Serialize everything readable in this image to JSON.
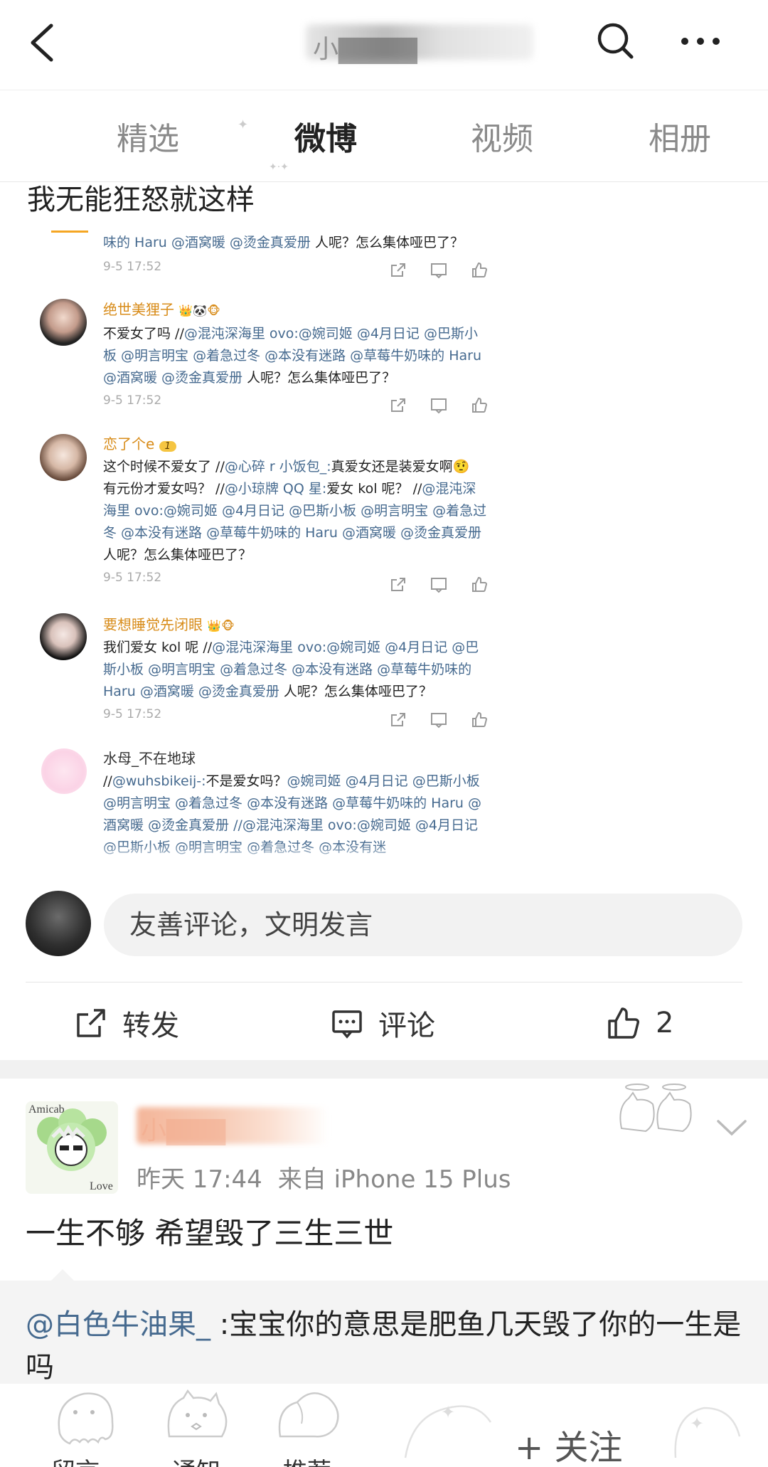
{
  "header": {
    "title": "小▇▇▇▇"
  },
  "tabs": [
    {
      "label": "精选",
      "active": false
    },
    {
      "label": "微博",
      "active": true
    },
    {
      "label": "视频",
      "active": false
    },
    {
      "label": "相册",
      "active": false
    }
  ],
  "embedded": {
    "heading": "我无能狂怒就这样",
    "comments": [
      {
        "name": "",
        "text_plain": "",
        "text_links": "味的 Haru @酒窝暖 @烫金真爱册 ",
        "text_tail": "人呢？怎么集体哑巴了？",
        "time": "9-5 17:52"
      },
      {
        "name": "绝世美狸子",
        "text_plain": "不爱女了吗 //",
        "text_links": "@混沌深海里 ovo:@婉司姬 @4月日记 @巴斯小板 @明言明宝  @着急过冬 @本没有迷路 @草莓牛奶味的 Haru @酒窝暖 @烫金真爱册 ",
        "text_tail": "人呢？怎么集体哑巴了？",
        "time": "9-5 17:52"
      },
      {
        "name": "恋了个e",
        "badge": "1",
        "text_plain": "这个时候不爱女了 //",
        "text_links": "@心碎 r 小饭包_:",
        "text_mid": "真爱女还是装爱女啊🤨 有元份才爱女吗？ //",
        "text_links2": "@小琼牌 QQ 星:",
        "text_mid2": "爱女 kol 呢？ //",
        "text_links3": "@混沌深海里 ovo:@婉司姬 @4月日记 @巴斯小板 @明言明宝  @着急过冬 @本没有迷路 @草莓牛奶味的 Haru @酒窝暖 @烫金真爱册 ",
        "text_tail": "人呢？怎么集体哑巴了？",
        "time": "9-5 17:52"
      },
      {
        "name": "要想睡觉先闭眼",
        "text_plain": "我们爱女 kol 呢 //",
        "text_links": "@混沌深海里 ovo:@婉司姬 @4月日记 @巴斯小板 @明言明宝  @着急过冬 @本没有迷路 @草莓牛奶味的 Haru @酒窝暖 @烫金真爱册 ",
        "text_tail": "人呢？怎么集体哑巴了？",
        "time": "9-5 17:52"
      },
      {
        "name": "水母_不在地球",
        "text_plain": "//",
        "text_links": "@wuhsbikeij-:",
        "text_mid": "不是爱女吗？",
        "text_links2": "@婉司姬 @4月日记 @巴斯小板 @明言明宝  @着急过冬 @本没有迷路 @草莓牛奶味的 Haru @酒窝暖 @烫金真爱册 //@混沌深海里 ovo:@婉司姬 @4月日记 @巴斯小板 @明言明宝  @着急过冬 @本没有迷",
        "time": ""
      }
    ]
  },
  "comment_input": {
    "placeholder": "友善评论，文明发言"
  },
  "actions": {
    "repost": "转发",
    "comment": "评论",
    "like_count": "2"
  },
  "post": {
    "avatar_text_top": "Amicab",
    "avatar_text_bottom": "Love",
    "author": "小▇▇▇",
    "time": "昨天 17:44",
    "source": "来自 iPhone 15 Plus",
    "body": "一生不够 希望毁了三生三世",
    "reply_mention": "@白色牛油果_",
    "reply_text": " :宝宝你的意思是肥鱼几天毁了你的一生是吗"
  },
  "bottom_bar": {
    "items": [
      "留言",
      "通知",
      "推荐"
    ],
    "follow": "+ 关注"
  }
}
